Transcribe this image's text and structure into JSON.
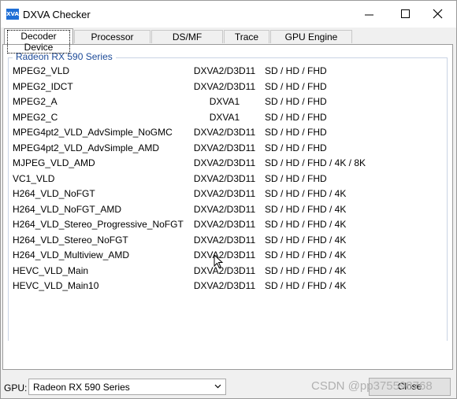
{
  "window": {
    "title": "DXVA Checker",
    "app_icon_text": "XVA"
  },
  "tabs": [
    {
      "label": "Decoder Device",
      "active": true
    },
    {
      "label": "Processor Device",
      "active": false
    },
    {
      "label": "DS/MF Decoder",
      "active": false
    },
    {
      "label": "Trace Log",
      "active": false
    },
    {
      "label": "GPU Engine Usage",
      "active": false
    }
  ],
  "group": {
    "title": "Radeon RX 590 Series"
  },
  "decoders": [
    {
      "name": "MPEG2_VLD",
      "api": "DXVA2/D3D11",
      "res": "SD / HD / FHD"
    },
    {
      "name": "MPEG2_IDCT",
      "api": "DXVA2/D3D11",
      "res": "SD / HD / FHD"
    },
    {
      "name": "MPEG2_A",
      "api": "DXVA1",
      "res": "SD / HD / FHD"
    },
    {
      "name": "MPEG2_C",
      "api": "DXVA1",
      "res": "SD / HD / FHD"
    },
    {
      "name": "MPEG4pt2_VLD_AdvSimple_NoGMC",
      "api": "DXVA2/D3D11",
      "res": "SD / HD / FHD"
    },
    {
      "name": "MPEG4pt2_VLD_AdvSimple_AMD",
      "api": "DXVA2/D3D11",
      "res": "SD / HD / FHD"
    },
    {
      "name": "MJPEG_VLD_AMD",
      "api": "DXVA2/D3D11",
      "res": "SD / HD / FHD / 4K / 8K"
    },
    {
      "name": "VC1_VLD",
      "api": "DXVA2/D3D11",
      "res": "SD / HD / FHD"
    },
    {
      "name": "H264_VLD_NoFGT",
      "api": "DXVA2/D3D11",
      "res": "SD / HD / FHD / 4K"
    },
    {
      "name": "H264_VLD_NoFGT_AMD",
      "api": "DXVA2/D3D11",
      "res": "SD / HD / FHD / 4K"
    },
    {
      "name": "H264_VLD_Stereo_Progressive_NoFGT",
      "api": "DXVA2/D3D11",
      "res": "SD / HD / FHD / 4K"
    },
    {
      "name": "H264_VLD_Stereo_NoFGT",
      "api": "DXVA2/D3D11",
      "res": "SD / HD / FHD / 4K"
    },
    {
      "name": "H264_VLD_Multiview_AMD",
      "api": "DXVA2/D3D11",
      "res": "SD / HD / FHD / 4K"
    },
    {
      "name": "HEVC_VLD_Main",
      "api": "DXVA2/D3D11",
      "res": "SD / HD / FHD / 4K"
    },
    {
      "name": "HEVC_VLD_Main10",
      "api": "DXVA2/D3D11",
      "res": "SD / HD / FHD / 4K"
    }
  ],
  "footer": {
    "gpu_label": "GPU:",
    "gpu_value": "Radeon RX 590 Series",
    "close_label": "Close"
  },
  "watermark": "CSDN @pp375598768",
  "colors": {
    "group_title": "#1c4a98",
    "app_icon": "#1f6fd6"
  }
}
